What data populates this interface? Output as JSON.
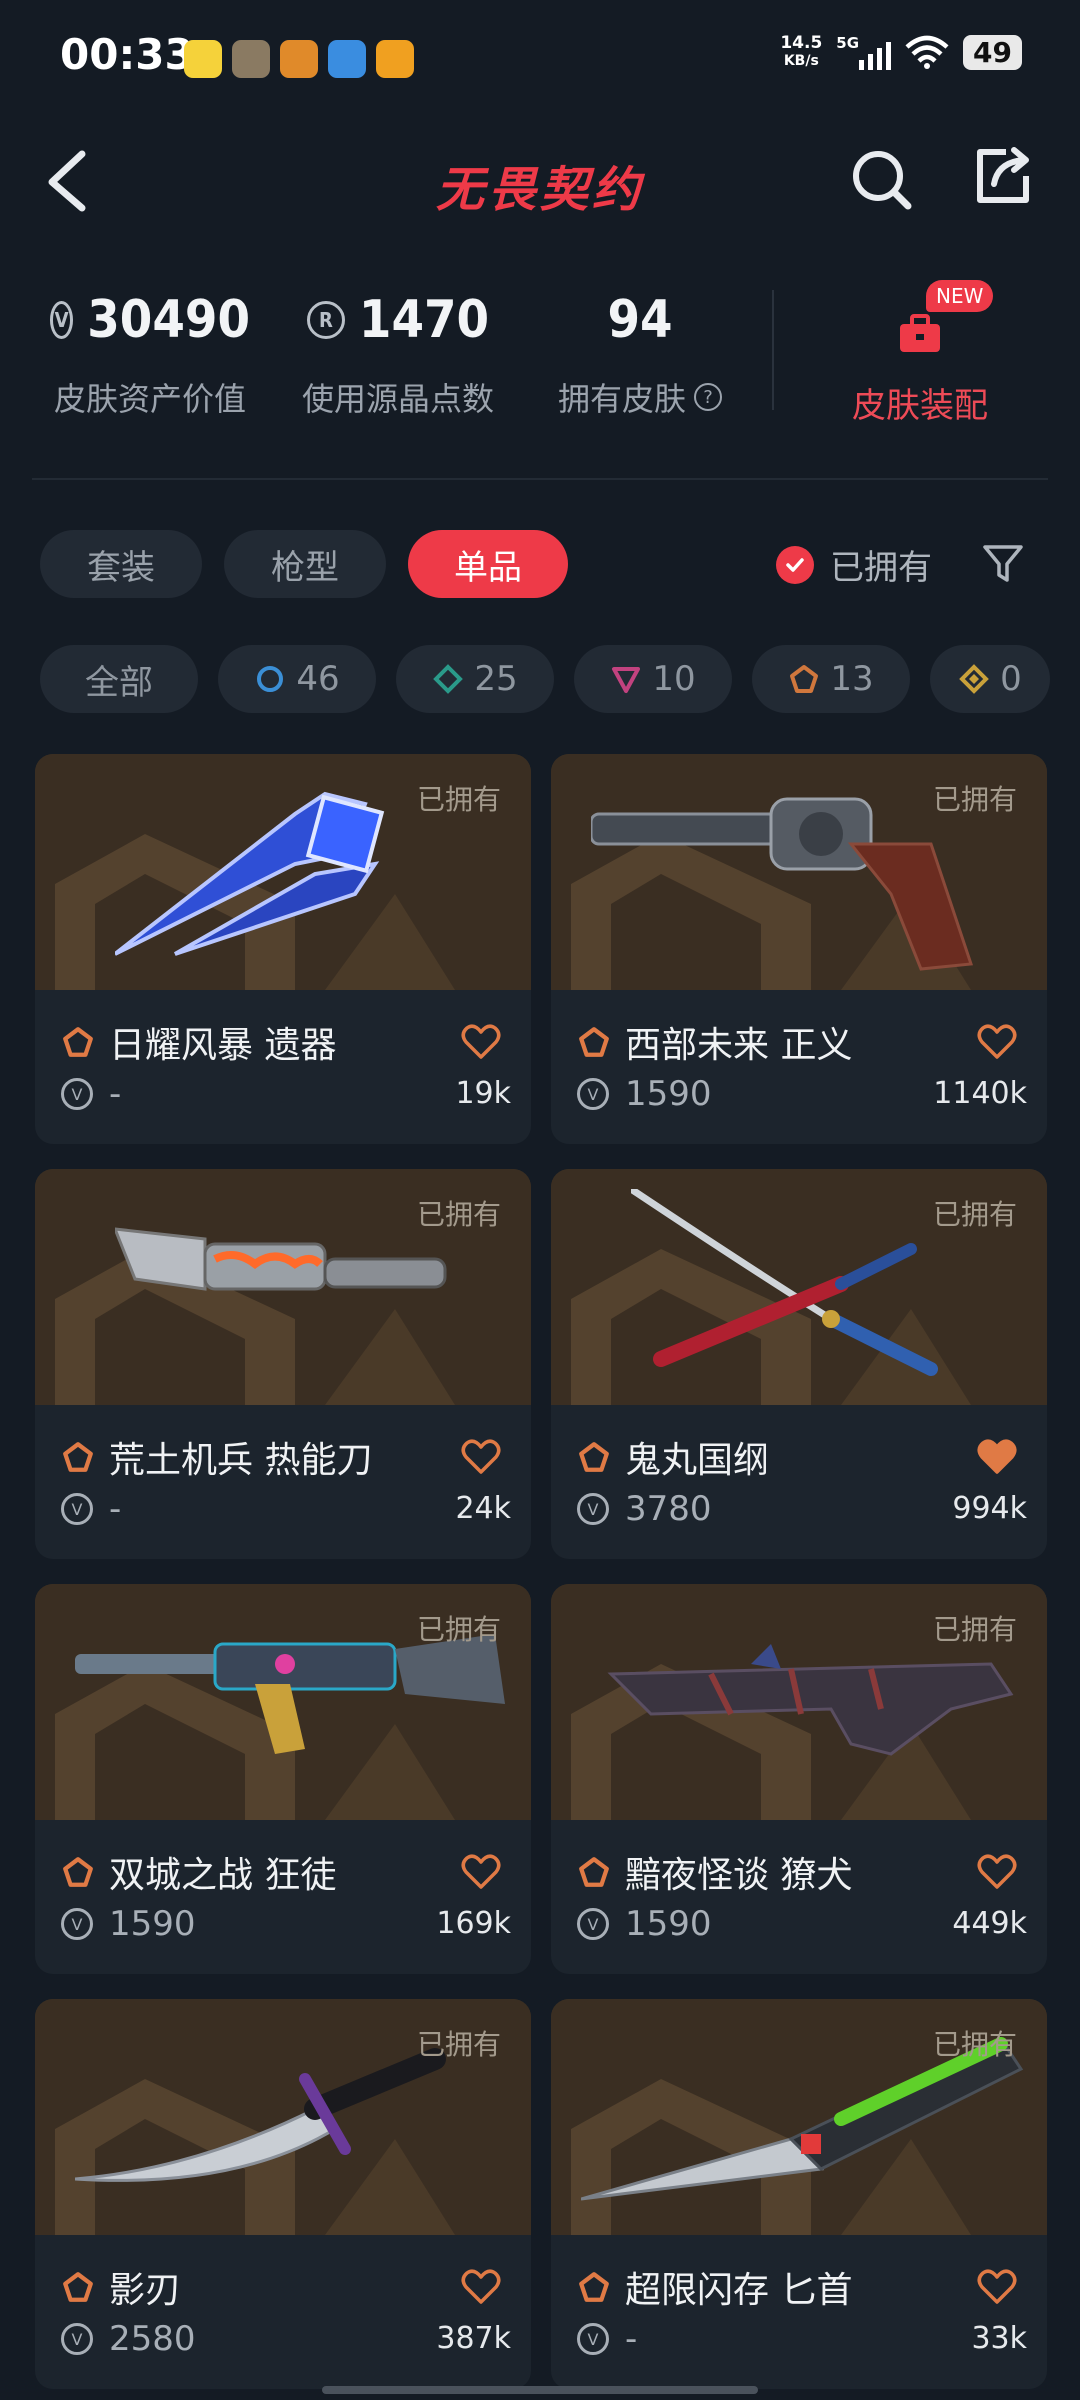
{
  "status_bar": {
    "time": "00:33",
    "speed_value": "14.5",
    "speed_unit": "KB/s",
    "network": "5G",
    "battery": "49"
  },
  "header": {
    "title": "无畏契约"
  },
  "stats": {
    "asset_value": "30490",
    "asset_label": "皮肤资产价值",
    "points": "1470",
    "points_label": "使用源晶点数",
    "owned": "94",
    "owned_label": "拥有皮肤",
    "new_badge": "NEW",
    "equip_label": "皮肤装配"
  },
  "tabs": [
    "套装",
    "枪型",
    "单品"
  ],
  "owned_filter": "已拥有",
  "tiers": [
    {
      "label": "全部"
    },
    {
      "count": "46",
      "color": "#3b8fd6"
    },
    {
      "count": "25",
      "color": "#2a9a8a"
    },
    {
      "count": "10",
      "color": "#c2427f"
    },
    {
      "count": "13",
      "color": "#d0773d"
    },
    {
      "count": "0",
      "color": "#c9a13a"
    }
  ],
  "items": [
    {
      "owned": "已拥有",
      "name": "日耀风暴 遗器",
      "price": "-",
      "likes": "19k",
      "liked": false
    },
    {
      "owned": "已拥有",
      "name": "西部未来 正义",
      "price": "1590",
      "likes": "1140k",
      "liked": false
    },
    {
      "owned": "已拥有",
      "name": "荒土机兵 热能刀",
      "price": "-",
      "likes": "24k",
      "liked": false
    },
    {
      "owned": "已拥有",
      "name": "鬼丸国纲",
      "price": "3780",
      "likes": "994k",
      "liked": true
    },
    {
      "owned": "已拥有",
      "name": "双城之战 狂徒",
      "price": "1590",
      "likes": "169k",
      "liked": false
    },
    {
      "owned": "已拥有",
      "name": "黯夜怪谈 獠犬",
      "price": "1590",
      "likes": "449k",
      "liked": false
    },
    {
      "owned": "已拥有",
      "name": "影刃",
      "price": "2580",
      "likes": "387k",
      "liked": false
    },
    {
      "owned": "已拥有",
      "name": "超限闪存 匕首",
      "price": "-",
      "likes": "33k",
      "liked": false
    }
  ],
  "colors": {
    "accent": "#ee3a48",
    "rank_orange": "#e07a45"
  }
}
